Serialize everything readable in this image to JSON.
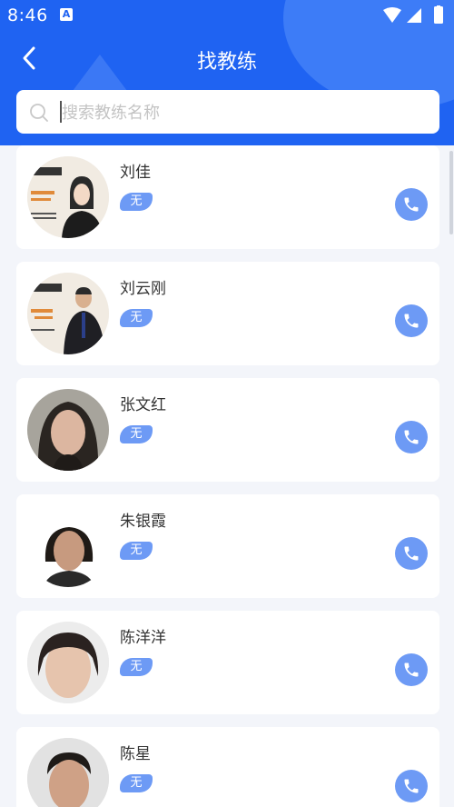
{
  "status_bar": {
    "time": "8:46",
    "app_icon": "A"
  },
  "header": {
    "title": "找教练"
  },
  "search": {
    "placeholder": "搜索教练名称",
    "value": ""
  },
  "coaches": [
    {
      "name": "刘佳",
      "tag": "无"
    },
    {
      "name": "刘云刚",
      "tag": "无"
    },
    {
      "name": "张文红",
      "tag": "无"
    },
    {
      "name": "朱银霞",
      "tag": "无"
    },
    {
      "name": "陈洋洋",
      "tag": "无"
    },
    {
      "name": "陈星",
      "tag": "无"
    }
  ],
  "colors": {
    "header": "#1f63f2",
    "accent": "#6d9af5",
    "background": "#f3f5fa"
  }
}
